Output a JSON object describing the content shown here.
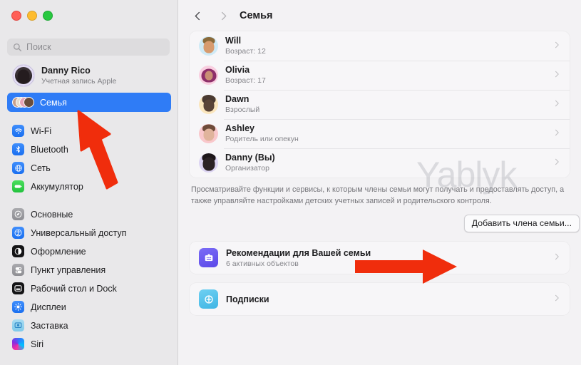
{
  "window": {
    "traffic_lights": [
      "close",
      "minimize",
      "zoom"
    ]
  },
  "sidebar": {
    "search": {
      "placeholder": "Поиск",
      "icon": "search-icon"
    },
    "account": {
      "name": "Danny Rico",
      "subtitle": "Учетная запись Apple",
      "avatar": "memoji-danny"
    },
    "items": [
      {
        "label": "Семья",
        "icon": "family-icon",
        "selected": true
      },
      {
        "label": "Wi-Fi",
        "icon": "wifi-icon",
        "selected": false
      },
      {
        "label": "Bluetooth",
        "icon": "bluetooth-icon",
        "selected": false
      },
      {
        "label": "Сеть",
        "icon": "network-icon",
        "selected": false
      },
      {
        "label": "Аккумулятор",
        "icon": "battery-icon",
        "selected": false
      },
      {
        "label": "Основные",
        "icon": "general-icon",
        "selected": false
      },
      {
        "label": "Универсальный доступ",
        "icon": "accessibility-icon",
        "selected": false
      },
      {
        "label": "Оформление",
        "icon": "appearance-icon",
        "selected": false
      },
      {
        "label": "Пункт управления",
        "icon": "control-center-icon",
        "selected": false
      },
      {
        "label": "Рабочий стол и Dock",
        "icon": "desktop-dock-icon",
        "selected": false
      },
      {
        "label": "Дисплеи",
        "icon": "displays-icon",
        "selected": false
      },
      {
        "label": "Заставка",
        "icon": "screensaver-icon",
        "selected": false
      },
      {
        "label": "Siri",
        "icon": "siri-icon",
        "selected": false
      }
    ]
  },
  "main": {
    "nav": {
      "back": "chevron-left-icon",
      "forward": "chevron-right-icon"
    },
    "title": "Семья",
    "members": [
      {
        "name": "Will",
        "role": "Возраст: 12"
      },
      {
        "name": "Olivia",
        "role": "Возраст: 17"
      },
      {
        "name": "Dawn",
        "role": "Взрослый"
      },
      {
        "name": "Ashley",
        "role": "Родитель или опекун"
      },
      {
        "name": "Danny (Вы)",
        "role": "Организатор"
      }
    ],
    "description": "Просматривайте функции и сервисы, к которым члены семьи могут получать и предоставлять доступ, а также управляйте настройками детских учетных записей и родительского контроля.",
    "add_member_button": "Добавить члена семьи...",
    "sections": [
      {
        "title": "Рекомендации для Вашей семьи",
        "subtitle": "6 активных объектов",
        "icon": "recommendations-icon"
      },
      {
        "title": "Подписки",
        "subtitle": "",
        "icon": "subscriptions-icon"
      }
    ]
  },
  "annotations": {
    "watermark": "Yablyk",
    "arrow_sidebar": "red-arrow-up-left",
    "arrow_button": "red-arrow-right",
    "arrow_color": "#f02d0c"
  },
  "colors": {
    "accent": "#2f7cf6",
    "sidebar_bg": "#e9e8ea",
    "main_bg": "#f3f2f4",
    "card_bg": "#f7f6f8"
  }
}
